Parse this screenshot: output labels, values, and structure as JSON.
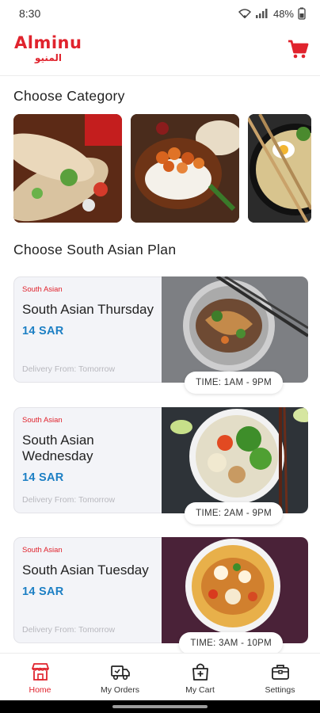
{
  "status_bar": {
    "time": "8:30",
    "battery": "48%"
  },
  "header": {
    "logo_text": "Alminu",
    "logo_arabic": "المنيو"
  },
  "categories": {
    "title": "Choose Category"
  },
  "plans": {
    "title": "Choose South Asian Plan",
    "items": [
      {
        "tag": "South Asian",
        "name": "South Asian Thursday",
        "price": "14 SAR",
        "delivery": "Delivery From: Tomorrow",
        "time": "TIME: 1AM - 9PM"
      },
      {
        "tag": "South Asian",
        "name": "South Asian Wednesday",
        "price": "14 SAR",
        "delivery": "Delivery From: Tomorrow",
        "time": "TIME: 2AM - 9PM"
      },
      {
        "tag": "South Asian",
        "name": "South Asian Tuesday",
        "price": "14 SAR",
        "delivery": "Delivery From: Tomorrow",
        "time": "TIME: 3AM - 10PM"
      }
    ]
  },
  "nav": {
    "items": [
      {
        "label": "Home",
        "icon": "store-icon",
        "active": true
      },
      {
        "label": "My Orders",
        "icon": "delivery-truck-icon"
      },
      {
        "label": "My Cart",
        "icon": "shopping-bag-icon"
      },
      {
        "label": "Settings",
        "icon": "briefcase-icon"
      }
    ]
  },
  "colors": {
    "brand": "#e0232d",
    "price": "#1c7fc4"
  }
}
